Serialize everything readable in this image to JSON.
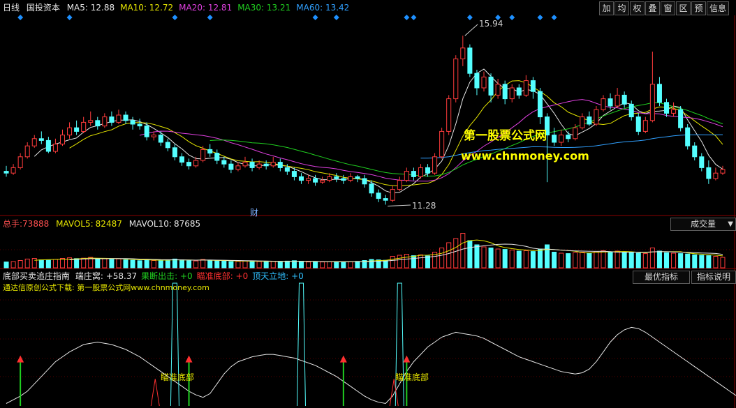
{
  "price_panel": {
    "period": "日线",
    "stock_name": "国投资本",
    "ma": [
      {
        "label": "MA5:",
        "value": "12.88",
        "color": "#e6e6e6"
      },
      {
        "label": "MA10:",
        "value": "12.72",
        "color": "#e6e600"
      },
      {
        "label": "MA20:",
        "value": "12.81",
        "color": "#e040e0"
      },
      {
        "label": "MA30:",
        "value": "13.21",
        "color": "#20d020"
      },
      {
        "label": "MA60:",
        "value": "13.42",
        "color": "#30a0ff"
      }
    ],
    "high_label": "15.94",
    "low_label": "11.28",
    "event_marker": "财",
    "watermark_title": "第一股票公式网",
    "watermark_url": "www.chnmoney.com"
  },
  "toolbar": [
    "加",
    "均",
    "权",
    "叠",
    "窗",
    "区",
    "预",
    "信息"
  ],
  "volume_panel": {
    "total_label": "总手:",
    "total_value": "73888",
    "mavol5_label": "MAVOL5:",
    "mavol5_value": "82487",
    "mavol10_label": "MAVOL10:",
    "mavol10_value": "87685",
    "dropdown": "成交量",
    "dropdown_arrow": "▼"
  },
  "indicator_panel": {
    "title": "底部买卖追庄指南",
    "stats": [
      {
        "label": "端庄窝:",
        "value": "+58.37",
        "color": "#e6e6e6"
      },
      {
        "label": "果断出击:",
        "value": "+0",
        "color": "#20d020"
      },
      {
        "label": "瞄准底部:",
        "value": "+0",
        "color": "#ff3030"
      },
      {
        "label": "顶天立地:",
        "value": "+0",
        "color": "#30c0ff"
      }
    ],
    "source_line": "通达信原创公式下载: 第一股票公式网www.chnmoney.com",
    "btn_best": "最优指标",
    "btn_help": "指标说明",
    "signal_labels": [
      "瞄准底部",
      "瞄准底部"
    ]
  },
  "colors": {
    "up": "#ff3c3c",
    "down": "#54ffff",
    "grid": "#8b0000",
    "white_line": "#e6e6e6"
  },
  "chart_data": {
    "type": "candlestick",
    "price_range": [
      11.0,
      16.5
    ],
    "candles": [
      [
        12.2,
        12.15,
        12.35,
        12.05
      ],
      [
        12.15,
        12.3,
        12.4,
        12.1
      ],
      [
        12.3,
        12.6,
        12.7,
        12.25
      ],
      [
        12.6,
        12.9,
        13.0,
        12.55
      ],
      [
        12.9,
        13.1,
        13.2,
        12.85
      ],
      [
        13.1,
        13.05,
        13.3,
        12.95
      ],
      [
        13.05,
        12.75,
        13.15,
        12.7
      ],
      [
        12.75,
        12.95,
        13.1,
        12.7
      ],
      [
        12.95,
        13.2,
        13.35,
        12.9
      ],
      [
        13.2,
        13.4,
        13.55,
        13.1
      ],
      [
        13.4,
        13.3,
        13.6,
        13.2
      ],
      [
        13.3,
        13.55,
        13.7,
        13.25
      ],
      [
        13.55,
        13.6,
        13.85,
        13.45
      ],
      [
        13.6,
        13.45,
        13.7,
        13.35
      ],
      [
        13.45,
        13.7,
        13.8,
        13.4
      ],
      [
        13.7,
        13.55,
        13.85,
        13.45
      ],
      [
        13.55,
        13.75,
        13.9,
        13.5
      ],
      [
        13.75,
        13.6,
        13.85,
        13.5
      ],
      [
        13.6,
        13.5,
        13.7,
        13.35
      ],
      [
        13.5,
        13.45,
        13.65,
        13.35
      ],
      [
        13.45,
        13.15,
        13.55,
        13.05
      ],
      [
        13.15,
        13.2,
        13.3,
        13.05
      ],
      [
        13.2,
        13.0,
        13.3,
        12.9
      ],
      [
        13.0,
        12.85,
        13.1,
        12.75
      ],
      [
        12.85,
        12.6,
        12.95,
        12.5
      ],
      [
        12.6,
        12.45,
        12.7,
        12.35
      ],
      [
        12.45,
        12.35,
        12.55,
        12.25
      ],
      [
        12.35,
        12.5,
        12.6,
        12.3
      ],
      [
        12.5,
        12.8,
        12.9,
        12.45
      ],
      [
        12.8,
        12.7,
        12.95,
        12.6
      ],
      [
        12.7,
        12.5,
        12.8,
        12.4
      ],
      [
        12.5,
        12.4,
        12.6,
        12.3
      ],
      [
        12.4,
        12.25,
        12.5,
        12.15
      ],
      [
        12.25,
        12.35,
        12.45,
        12.2
      ],
      [
        12.35,
        12.45,
        12.6,
        12.3
      ],
      [
        12.45,
        12.3,
        12.55,
        12.2
      ],
      [
        12.3,
        12.4,
        12.5,
        12.25
      ],
      [
        12.4,
        12.35,
        12.5,
        12.25
      ],
      [
        12.35,
        12.45,
        12.6,
        12.3
      ],
      [
        12.45,
        12.3,
        12.55,
        12.2
      ],
      [
        12.3,
        12.2,
        12.4,
        12.1
      ],
      [
        12.2,
        12.05,
        12.3,
        11.95
      ],
      [
        12.05,
        11.95,
        12.15,
        11.85
      ],
      [
        11.95,
        12.0,
        12.1,
        11.85
      ],
      [
        12.0,
        11.9,
        12.1,
        11.8
      ],
      [
        11.9,
        11.95,
        12.05,
        11.85
      ],
      [
        11.95,
        12.05,
        12.15,
        11.9
      ],
      [
        12.05,
        12.0,
        12.15,
        11.9
      ],
      [
        12.0,
        11.95,
        12.1,
        11.85
      ],
      [
        11.95,
        12.05,
        12.15,
        11.9
      ],
      [
        12.05,
        12.0,
        12.1,
        11.9
      ],
      [
        12.0,
        11.85,
        12.1,
        11.75
      ],
      [
        11.85,
        11.6,
        11.95,
        11.5
      ],
      [
        11.6,
        11.45,
        11.7,
        11.35
      ],
      [
        11.45,
        11.4,
        11.55,
        11.28
      ],
      [
        11.4,
        11.7,
        11.8,
        11.35
      ],
      [
        11.7,
        11.95,
        12.05,
        11.65
      ],
      [
        11.95,
        12.2,
        12.3,
        11.9
      ],
      [
        12.2,
        12.05,
        12.3,
        11.95
      ],
      [
        12.05,
        12.3,
        12.4,
        12.0
      ],
      [
        12.3,
        12.15,
        12.4,
        12.05
      ],
      [
        12.15,
        12.6,
        12.7,
        12.1
      ],
      [
        12.6,
        13.3,
        13.4,
        12.55
      ],
      [
        13.3,
        14.2,
        14.3,
        13.2
      ],
      [
        14.2,
        15.3,
        15.4,
        14.1
      ],
      [
        15.3,
        15.6,
        15.94,
        15.1
      ],
      [
        15.6,
        14.9,
        15.7,
        14.8
      ],
      [
        14.9,
        14.5,
        15.0,
        14.3
      ],
      [
        14.5,
        14.8,
        14.95,
        14.4
      ],
      [
        14.8,
        14.3,
        14.9,
        14.1
      ],
      [
        14.3,
        14.6,
        14.75,
        14.2
      ],
      [
        14.6,
        14.2,
        14.7,
        14.05
      ],
      [
        14.2,
        14.5,
        14.6,
        14.1
      ],
      [
        14.5,
        14.3,
        14.6,
        14.2
      ],
      [
        14.3,
        14.7,
        14.85,
        14.25
      ],
      [
        14.7,
        14.4,
        14.8,
        14.2
      ],
      [
        14.4,
        13.7,
        14.5,
        13.5
      ],
      [
        13.7,
        13.2,
        13.8,
        11.9
      ],
      [
        13.2,
        13.0,
        13.4,
        12.9
      ],
      [
        13.0,
        13.2,
        13.35,
        12.9
      ],
      [
        13.2,
        13.1,
        13.3,
        13.0
      ],
      [
        13.1,
        13.4,
        13.5,
        13.05
      ],
      [
        13.4,
        13.7,
        13.8,
        13.35
      ],
      [
        13.7,
        13.5,
        13.85,
        13.45
      ],
      [
        13.5,
        13.9,
        14.0,
        13.45
      ],
      [
        13.9,
        14.2,
        14.3,
        13.85
      ],
      [
        14.2,
        14.0,
        14.35,
        13.9
      ],
      [
        14.0,
        14.3,
        14.5,
        13.95
      ],
      [
        14.3,
        14.05,
        14.4,
        13.95
      ],
      [
        14.05,
        13.7,
        14.15,
        13.6
      ],
      [
        13.7,
        13.3,
        13.8,
        13.2
      ],
      [
        13.3,
        13.6,
        13.7,
        13.25
      ],
      [
        13.6,
        14.6,
        15.5,
        13.55
      ],
      [
        14.6,
        14.1,
        14.8,
        14.0
      ],
      [
        14.1,
        13.8,
        14.2,
        13.7
      ],
      [
        13.8,
        13.9,
        14.1,
        13.7
      ],
      [
        13.9,
        13.4,
        14.0,
        13.3
      ],
      [
        13.4,
        12.9,
        13.5,
        12.8
      ],
      [
        12.9,
        12.6,
        13.0,
        12.5
      ],
      [
        12.6,
        12.3,
        12.7,
        12.2
      ],
      [
        12.3,
        12.0,
        12.5,
        11.85
      ],
      [
        12.0,
        12.15,
        12.3,
        11.95
      ],
      [
        12.15,
        12.25,
        12.35,
        12.1
      ]
    ],
    "volume_range": [
      0,
      180000
    ],
    "volumes": [
      28000,
      30000,
      35000,
      42000,
      45000,
      38000,
      36000,
      40000,
      45000,
      48000,
      44000,
      46000,
      50000,
      42000,
      45000,
      40000,
      43000,
      38000,
      36000,
      34000,
      40000,
      35000,
      38000,
      36000,
      42000,
      38000,
      34000,
      33000,
      40000,
      36000,
      34000,
      32000,
      30000,
      31000,
      33000,
      32000,
      30000,
      29000,
      31000,
      30000,
      32000,
      34000,
      30000,
      28000,
      29000,
      28000,
      30000,
      29000,
      28000,
      30000,
      31000,
      35000,
      40000,
      38000,
      36000,
      55000,
      60000,
      65000,
      58000,
      62000,
      57000,
      75000,
      95000,
      120000,
      140000,
      165000,
      130000,
      110000,
      100000,
      95000,
      90000,
      88000,
      85000,
      80000,
      82000,
      78000,
      90000,
      110000,
      75000,
      70000,
      68000,
      72000,
      75000,
      70000,
      78000,
      82000,
      76000,
      80000,
      74000,
      72000,
      70000,
      68000,
      95000,
      80000,
      72000,
      70000,
      68000,
      66000,
      62000,
      60000,
      58000,
      55000,
      50000
    ],
    "indicator_range": [
      0,
      100
    ],
    "indicator_white": [
      2,
      5,
      8,
      12,
      18,
      24,
      30,
      36,
      40,
      44,
      47,
      50,
      51,
      52,
      51,
      50,
      48,
      46,
      43,
      40,
      36,
      32,
      28,
      24,
      20,
      16,
      12,
      9,
      7,
      10,
      18,
      26,
      32,
      36,
      38,
      40,
      41,
      42,
      42,
      41,
      40,
      39,
      37,
      35,
      33,
      30,
      27,
      24,
      20,
      16,
      12,
      8,
      5,
      3,
      2,
      8,
      18,
      28,
      36,
      42,
      48,
      52,
      56,
      58,
      60,
      59,
      58,
      57,
      55,
      52,
      49,
      46,
      43,
      40,
      38,
      36,
      34,
      32,
      30,
      28,
      27,
      26,
      27,
      30,
      36,
      44,
      52,
      58,
      62,
      64,
      63,
      60,
      56,
      52,
      48,
      44,
      40,
      36,
      32,
      28,
      24,
      20,
      16,
      12,
      8,
      6,
      4
    ],
    "indicator_cyan_peaks": [
      24,
      42,
      56
    ],
    "indicator_green_arrows": [
      2,
      26,
      48,
      57
    ],
    "indicator_red_triangles": [
      21,
      55
    ]
  }
}
